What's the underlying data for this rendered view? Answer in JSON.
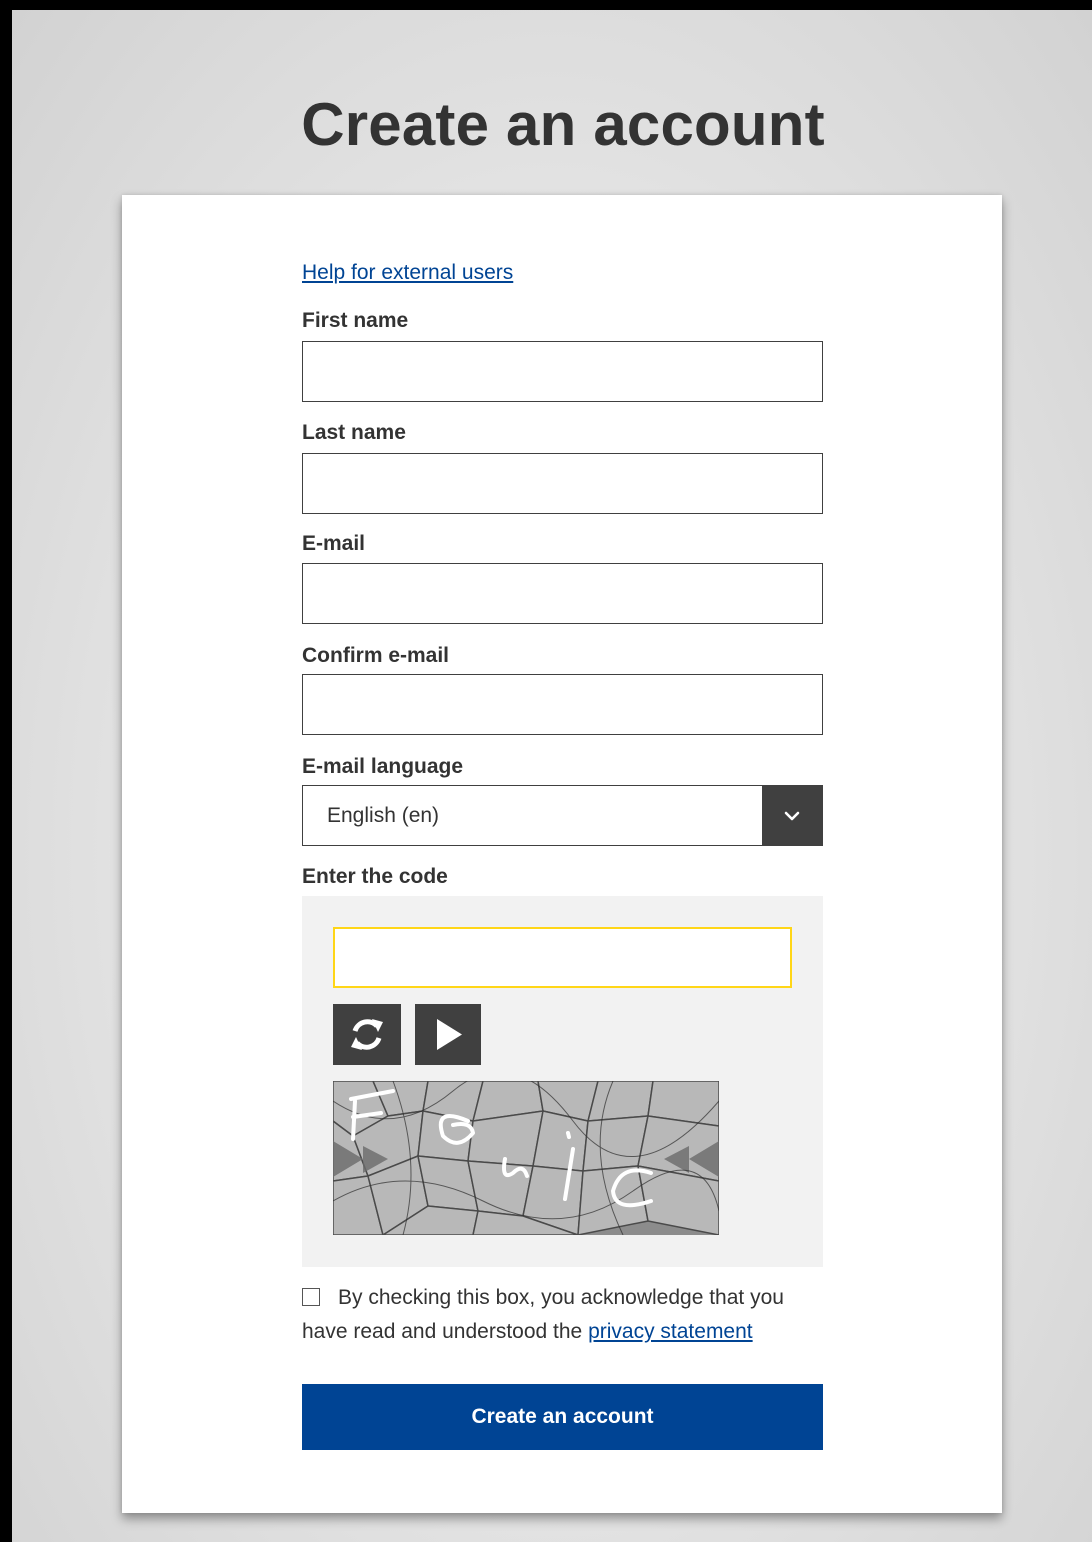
{
  "page": {
    "title": "Create an account"
  },
  "form": {
    "help_link": "Help for external users",
    "first_name": {
      "label": "First name",
      "value": ""
    },
    "last_name": {
      "label": "Last name",
      "value": ""
    },
    "email": {
      "label": "E-mail",
      "value": ""
    },
    "confirm_email": {
      "label": "Confirm e-mail",
      "value": ""
    },
    "email_language": {
      "label": "E-mail language",
      "selected": "English (en)"
    },
    "captcha": {
      "label": "Enter the code",
      "value": "",
      "refresh_icon": "refresh-icon",
      "play_icon": "play-icon"
    },
    "consent": {
      "text_before": "By checking this box, you acknowledge that you have read and understood the ",
      "link": "privacy statement",
      "checked": false
    },
    "submit_label": "Create an account"
  },
  "colors": {
    "primary": "#004494",
    "captcha_border": "#ffd617",
    "dark_control": "#404040",
    "text": "#333333"
  }
}
